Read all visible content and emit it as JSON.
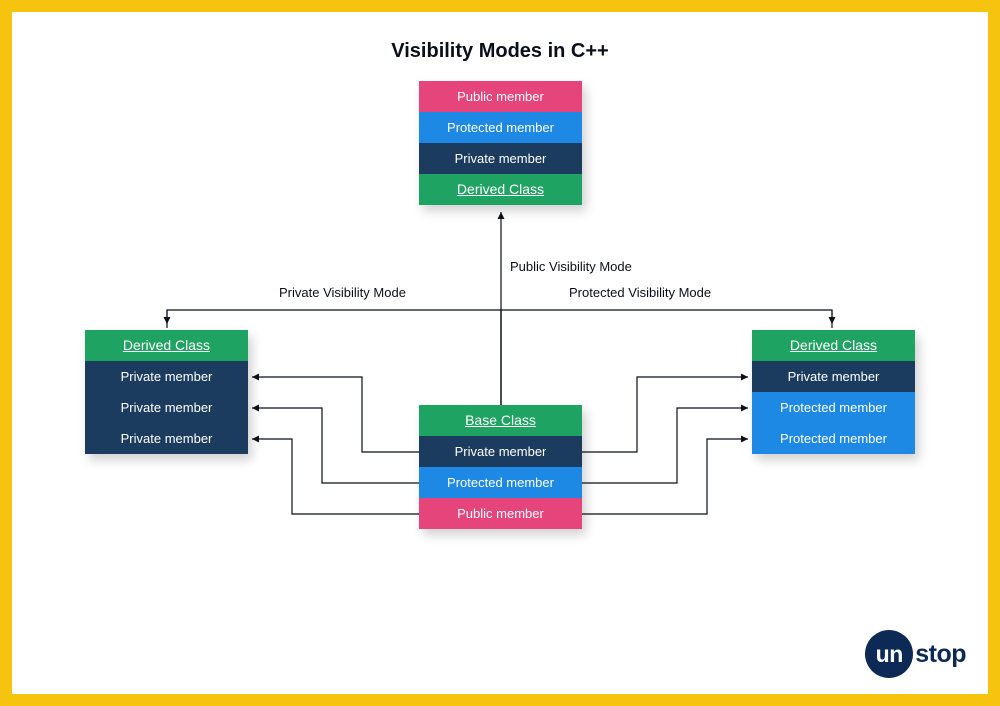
{
  "title": "Visibility Modes in C++",
  "topDerived": {
    "header": "Derived Class",
    "rows": [
      {
        "text": "Public member",
        "cls": "pink"
      },
      {
        "text": "Protected member",
        "cls": "blue"
      },
      {
        "text": "Private member",
        "cls": "navy"
      }
    ]
  },
  "leftDerived": {
    "header": "Derived Class",
    "rows": [
      {
        "text": "Private member",
        "cls": "navy"
      },
      {
        "text": "Private member",
        "cls": "navy"
      },
      {
        "text": "Private member",
        "cls": "navy"
      }
    ]
  },
  "rightDerived": {
    "header": "Derived Class",
    "rows": [
      {
        "text": "Private member",
        "cls": "navy"
      },
      {
        "text": "Protected member",
        "cls": "blue"
      },
      {
        "text": "Protected member",
        "cls": "blue"
      }
    ]
  },
  "base": {
    "header": "Base Class",
    "rows": [
      {
        "text": "Private member",
        "cls": "navy"
      },
      {
        "text": "Protected member",
        "cls": "blue"
      },
      {
        "text": "Public member",
        "cls": "pink"
      }
    ]
  },
  "labels": {
    "public": "Public Visibility Mode",
    "private": "Private Visibility Mode",
    "protected": "Protected Visibility Mode"
  },
  "brand": {
    "prefix": "un",
    "suffix": "stop"
  }
}
